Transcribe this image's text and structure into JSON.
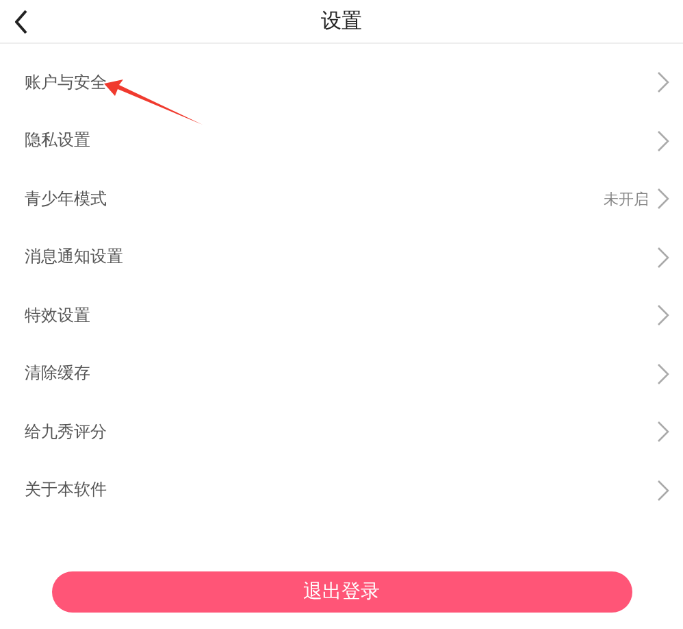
{
  "header": {
    "title": "设置"
  },
  "items": [
    {
      "label": "账户与安全"
    },
    {
      "label": "隐私设置"
    },
    {
      "label": "青少年模式",
      "value": "未开启"
    },
    {
      "label": "消息通知设置"
    },
    {
      "label": "特效设置"
    },
    {
      "label": "清除缓存"
    },
    {
      "label": "给九秀评分"
    },
    {
      "label": "关于本软件"
    }
  ],
  "logout_button": "退出登录"
}
